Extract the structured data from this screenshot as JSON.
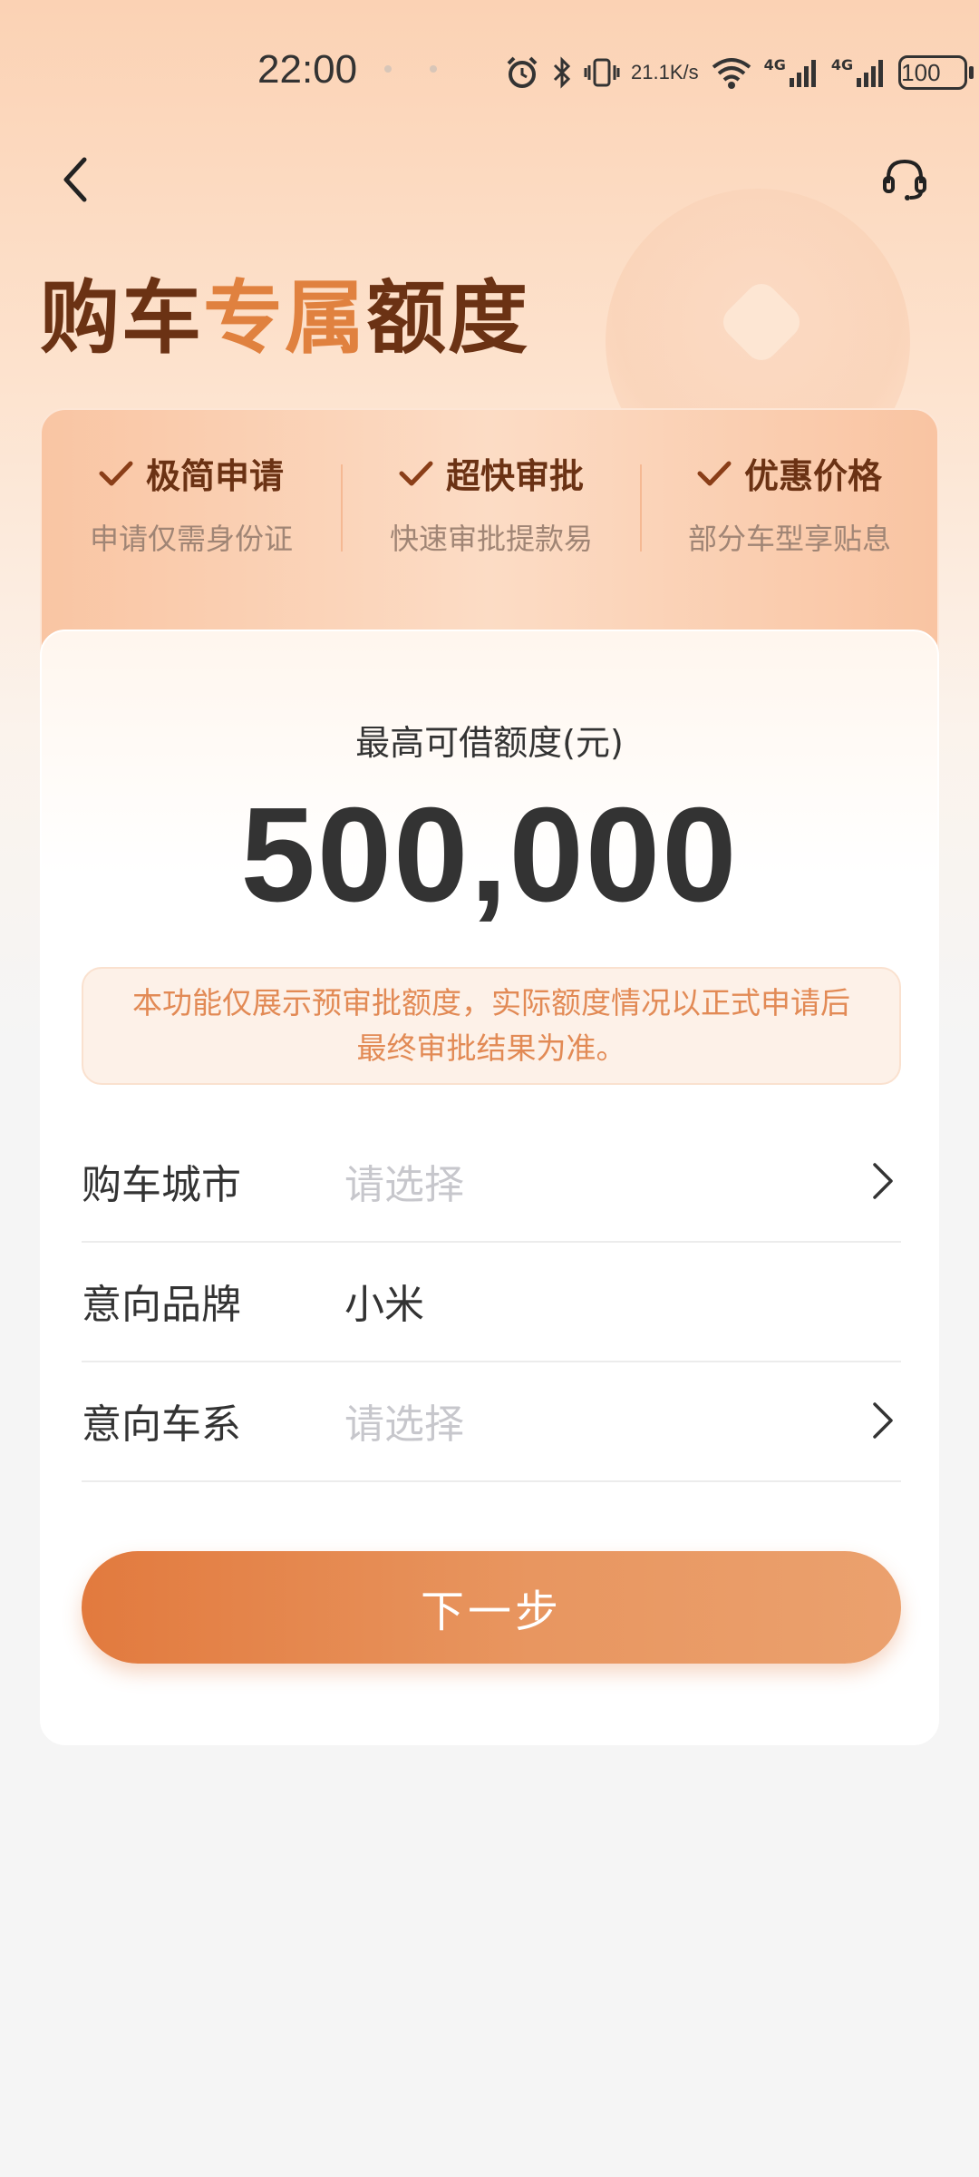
{
  "status_bar": {
    "time": "22:00",
    "net_speed_value": "21.1",
    "net_speed_unit": "K/s",
    "signal1": "4G",
    "signal2": "4G",
    "battery": "100"
  },
  "nav": {
    "back_icon": "chevron-left-icon",
    "service_icon": "headset-icon"
  },
  "title": {
    "part1": "购车",
    "part2": "专属",
    "part3": "额度"
  },
  "features": [
    {
      "title": "极简申请",
      "subtitle": "申请仅需身份证"
    },
    {
      "title": "超快审批",
      "subtitle": "快速审批提款易"
    },
    {
      "title": "优惠价格",
      "subtitle": "部分车型享贴息"
    }
  ],
  "limit": {
    "label": "最高可借额度(元)",
    "value": "500,000"
  },
  "notice": "本功能仅展示预审批额度，实际额度情况以正式申请后最终审批结果为准。",
  "form": {
    "rows": [
      {
        "label": "购车城市",
        "value": "请选择",
        "placeholder": true,
        "chevron": true
      },
      {
        "label": "意向品牌",
        "value": "小米",
        "placeholder": false,
        "chevron": false
      },
      {
        "label": "意向车系",
        "value": "请选择",
        "placeholder": true,
        "chevron": true
      }
    ]
  },
  "next_button": "下一步",
  "colors": {
    "accent": "#e27a3e",
    "title_dark": "#6b3214",
    "notice_text": "#e28a55"
  }
}
